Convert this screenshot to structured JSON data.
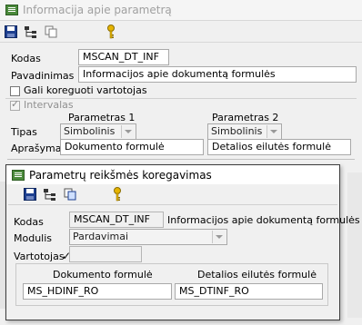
{
  "main_window": {
    "title": "Informacija apie parametrą",
    "fields": {
      "kodas_label": "Kodas",
      "kodas_value": "MSCAN_DT_INF",
      "pavadinimas_label": "Pavadinimas",
      "pavadinimas_value": "Informacijos apie dokumentą formulės",
      "gali_label": "Gali koreguoti vartotojas",
      "intervalas_label": "Intervalas"
    },
    "params": {
      "col1_header": "Parametras 1",
      "col2_header": "Parametras 2",
      "tipas_label": "Tipas",
      "aprasymas_label": "Aprašymas",
      "tipas1": "Simbolinis",
      "tipas2": "Simbolinis",
      "apr1": "Dokumento formulė",
      "apr2": "Detalios eilutės formulė"
    }
  },
  "dialog": {
    "title": "Parametrų reikšmės koregavimas",
    "kodas_label": "Kodas",
    "kodas_value": "MSCAN_DT_INF",
    "kodas_desc": "Informacijos apie dokumentą formulės",
    "modulis_label": "Modulis",
    "modulis_value": "Pardavimai",
    "vartotojas_label": "Vartotojas",
    "vartotojas_mark": "✓",
    "col1_header": "Dokumento formulė",
    "col2_header": "Detalios eilutės formulė",
    "val1": "MS_HDINF_RO",
    "val2": "MS_DTINF_RO"
  },
  "colors": {
    "main_title_text": "#a0a0a0",
    "dialog_border": "#3c3c3c",
    "key_yellow": "#e6b400"
  },
  "icons": [
    "save-icon",
    "tree-icon",
    "copy-icon",
    "key-icon"
  ]
}
